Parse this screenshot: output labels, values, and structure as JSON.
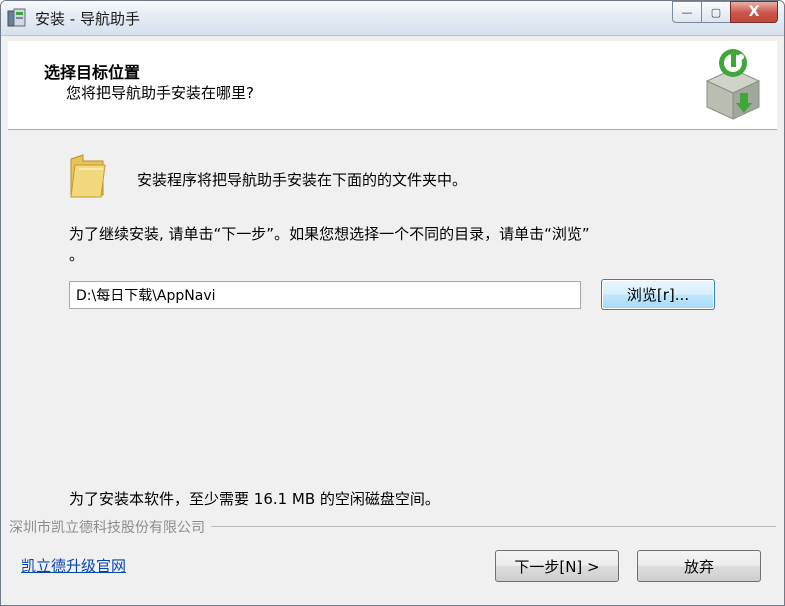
{
  "window": {
    "title": "安装 - 导航助手",
    "controls": {
      "minimize": "—",
      "maximize": "▢",
      "close": "X"
    }
  },
  "header": {
    "title": "选择目标位置",
    "subtitle": "您将把导航助手安装在哪里?"
  },
  "body": {
    "intro": "安装程序将把导航助手安装在下面的的文件夹中。",
    "instruction_line1": "为了继续安装, 请单击“下一步”。如果您想选择一个不同的目录，请单击“浏览”",
    "instruction_line2": "。",
    "path_value": "D:\\每日下载\\AppNavi",
    "browse_button": "浏览[r]...",
    "space_required": "为了安装本软件，至少需要 16.1 MB 的空闲磁盘空间。"
  },
  "footer": {
    "company": "深圳市凯立德科技股份有限公司",
    "upgrade_link": "凯立德升级官网",
    "next_button": "下一步[N] >",
    "cancel_button": "放弃"
  },
  "icons": [
    "app-icon",
    "installer-logo-icon",
    "folder-icon"
  ],
  "colors": {
    "accent": "#3c7fb1",
    "link": "#0645ad",
    "logo_green": "#3fa63a"
  }
}
